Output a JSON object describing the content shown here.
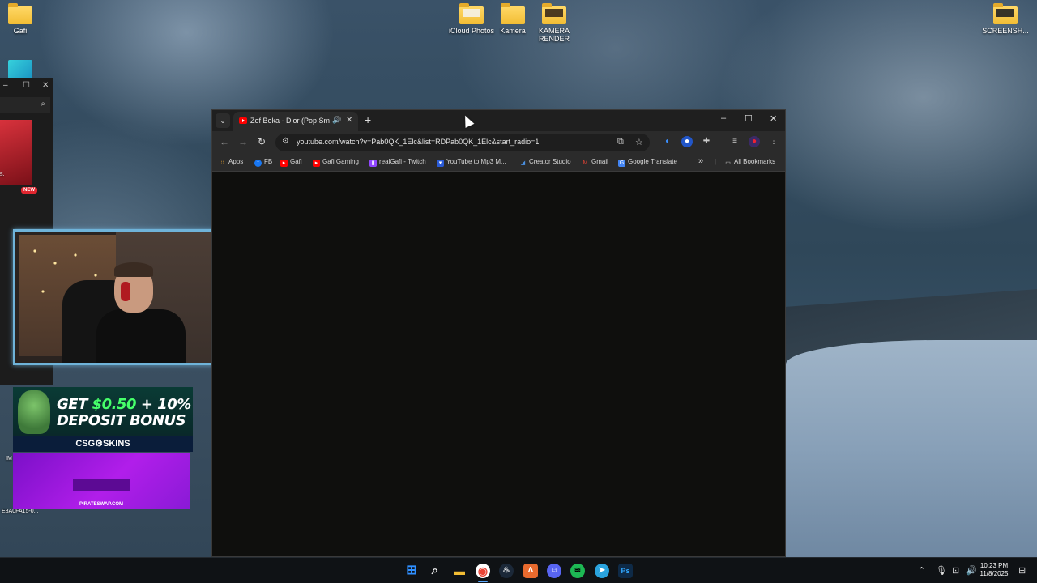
{
  "desktop": {
    "icons": [
      {
        "label": "Gafi",
        "type": "folder"
      },
      {
        "label": "iCloud Photos",
        "type": "folder"
      },
      {
        "label": "Kamera",
        "type": "folder"
      },
      {
        "label": "KAMERA RENDER",
        "type": "folder"
      },
      {
        "label": "SCREENSH...",
        "type": "folder"
      }
    ],
    "side_labels": [
      "E8A0FA15-0...",
      "s.",
      "IM"
    ]
  },
  "left_window": {
    "new_badge": "NEW"
  },
  "ads": {
    "csgo": {
      "headline_a": "GET ",
      "headline_accent": "$0.50",
      "headline_b": " + 10%",
      "headline_c": "DEPOSIT BONUS",
      "brand": "CSG⚙SKINS"
    },
    "pirateswap": {
      "domain": "PIRATESWAP.COM"
    }
  },
  "browser": {
    "tab": {
      "title": "Zef Beka - Dior (Pop Smoke",
      "audio_icon": "🔊",
      "close": "✕"
    },
    "new_tab": "+",
    "window_controls": {
      "minimize": "–",
      "maximize": "☐",
      "close": "✕"
    },
    "url": "youtube.com/watch?v=Pab0QK_1Elc&list=RDPab0QK_1Elc&start_radio=1",
    "bookmarks": [
      {
        "label": "Apps",
        "icon": "apps-grid-icon",
        "color": "#e0a030"
      },
      {
        "label": "FB",
        "icon": "facebook-icon",
        "color": "#1877f2"
      },
      {
        "label": "Gafi",
        "icon": "youtube-icon",
        "color": "#ff0000"
      },
      {
        "label": "Gafi Gaming",
        "icon": "youtube-icon",
        "color": "#ff0000"
      },
      {
        "label": "realGafi - Twitch",
        "icon": "twitch-icon",
        "color": "#9146ff"
      },
      {
        "label": "YouTube to Mp3 M...",
        "icon": "shield-icon",
        "color": "#2a5bd7"
      },
      {
        "label": "Creator Studio",
        "icon": "creator-studio-icon",
        "color": "#4a90e2"
      },
      {
        "label": "Gmail",
        "icon": "gmail-icon",
        "color": "#ea4335"
      },
      {
        "label": "Google Translate",
        "icon": "translate-icon",
        "color": "#4285f4"
      }
    ],
    "more_bookmarks": "»",
    "all_bookmarks": "All Bookmarks"
  },
  "taskbar": {
    "apps": [
      {
        "name": "start",
        "glyph": "⊞",
        "color": "#2f8fff"
      },
      {
        "name": "search",
        "glyph": "⌕",
        "color": "transparent"
      },
      {
        "name": "file-explorer",
        "glyph": "▬",
        "color": "#f2bd34"
      },
      {
        "name": "chrome",
        "glyph": "◉",
        "color": "#34a853"
      },
      {
        "name": "steam",
        "glyph": "♨",
        "color": "#1b2838"
      },
      {
        "name": "arc",
        "glyph": "Λ",
        "color": "#e86a2e"
      },
      {
        "name": "discord",
        "glyph": "☺",
        "color": "#5865f2"
      },
      {
        "name": "spotify",
        "glyph": "≋",
        "color": "#1db954"
      },
      {
        "name": "telegram",
        "glyph": "➤",
        "color": "#2aa3de"
      },
      {
        "name": "photoshop",
        "glyph": "Ps",
        "color": "#0e2a47"
      }
    ],
    "time": "10:23 PM",
    "date": "11/8/2025"
  }
}
